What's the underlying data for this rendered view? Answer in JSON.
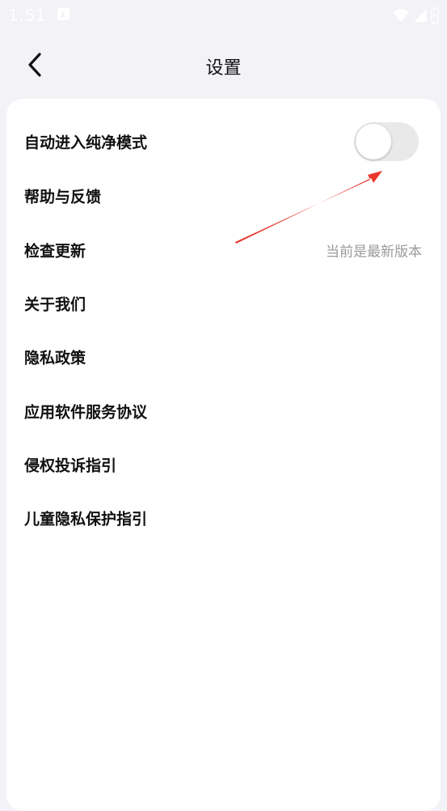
{
  "status_bar": {
    "time": "1:51"
  },
  "header": {
    "title": "设置"
  },
  "settings": {
    "pure_mode": {
      "label": "自动进入纯净模式",
      "enabled": false
    },
    "help_feedback": {
      "label": "帮助与反馈"
    },
    "check_update": {
      "label": "检查更新",
      "value": "当前是最新版本"
    },
    "about_us": {
      "label": "关于我们"
    },
    "privacy_policy": {
      "label": "隐私政策"
    },
    "service_agreement": {
      "label": "应用软件服务协议"
    },
    "infringement_guide": {
      "label": "侵权投诉指引"
    },
    "child_privacy_guide": {
      "label": "儿童隐私保护指引"
    }
  },
  "colors": {
    "background": "#f2f2f7",
    "card": "#ffffff",
    "text_primary": "#111111",
    "text_secondary": "#9a9a9a",
    "toggle_off": "#e9e9ea",
    "annotation_arrow": "#e8362d"
  },
  "icons": {
    "back": "chevron-left-icon",
    "wifi": "wifi-icon",
    "signal": "cellular-signal-icon",
    "battery": "battery-icon",
    "notification": "notification-a-icon"
  }
}
